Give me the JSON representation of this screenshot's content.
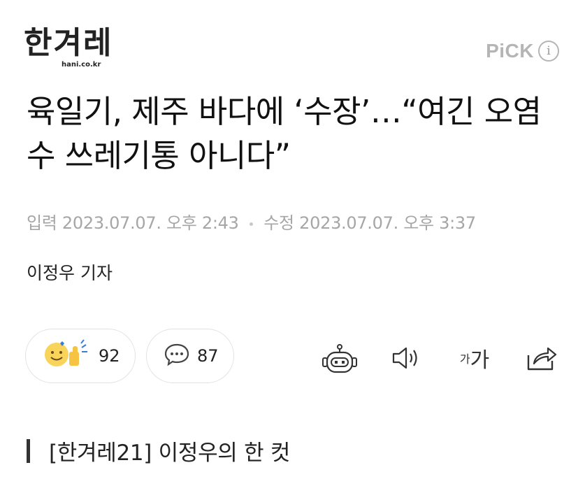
{
  "header": {
    "logo_text": "한겨레",
    "logo_domain": "hani.co.kr",
    "pick_label": "PiCK",
    "info_icon": "info-icon"
  },
  "article": {
    "title": "육일기, 제주 바다에 ‘수장’…“여긴 오염수 쓰레기통 아니다”",
    "input_label": "입력",
    "input_time": "2023.07.07. 오후 2:43",
    "modified_label": "수정",
    "modified_time": "2023.07.07. 오후 3:37",
    "author": "이정우 기자"
  },
  "actions": {
    "reaction_count": "92",
    "comment_count": "87",
    "font_small": "가",
    "font_big": "가"
  },
  "subhead": "[한겨레21] 이정우의 한 컷"
}
